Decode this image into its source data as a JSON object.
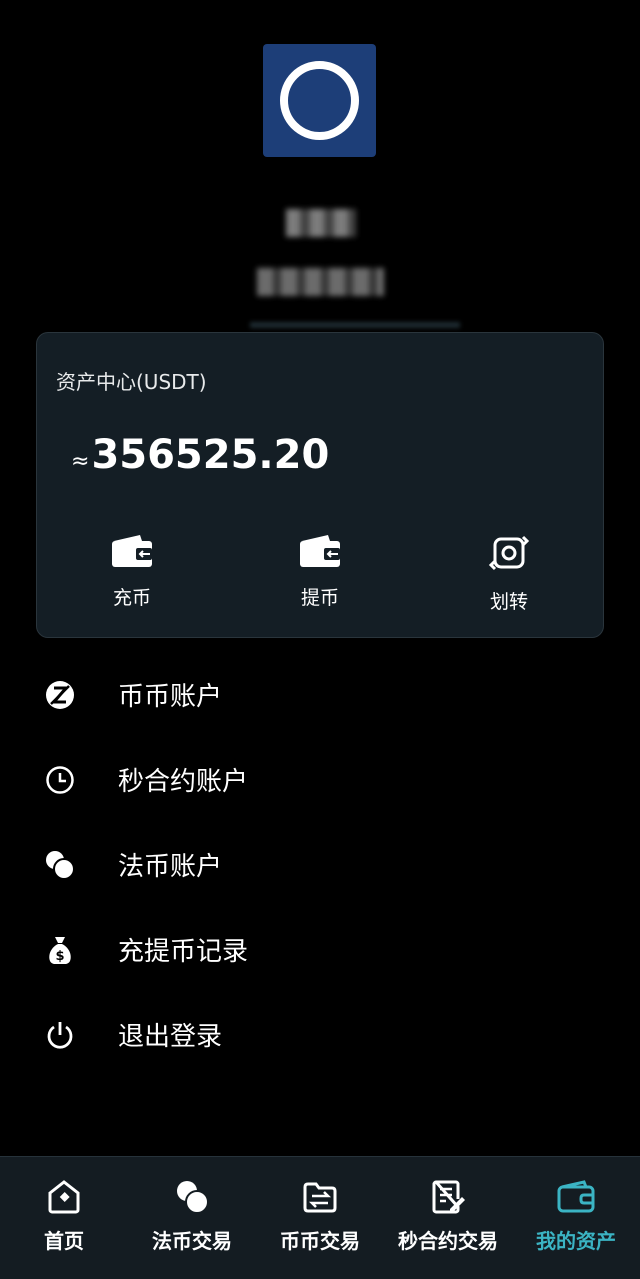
{
  "card": {
    "title": "资产中心(USDT)",
    "approx": "≈",
    "balance": "356525.20",
    "actions": [
      {
        "label": "充币",
        "icon": "wallet-deposit-icon"
      },
      {
        "label": "提币",
        "icon": "wallet-withdraw-icon"
      },
      {
        "label": "划转",
        "icon": "transfer-icon"
      }
    ]
  },
  "menu": {
    "items": [
      {
        "label": "币币账户",
        "icon": "coin-account-icon"
      },
      {
        "label": "秒合约账户",
        "icon": "clock-icon"
      },
      {
        "label": "法币账户",
        "icon": "fiat-circles-icon"
      },
      {
        "label": "充提币记录",
        "icon": "money-bag-icon"
      },
      {
        "label": "退出登录",
        "icon": "power-icon"
      }
    ]
  },
  "nav": {
    "items": [
      {
        "label": "首页",
        "icon": "home-icon"
      },
      {
        "label": "法币交易",
        "icon": "fiat-trade-icon"
      },
      {
        "label": "币币交易",
        "icon": "folder-exchange-icon"
      },
      {
        "label": "秒合约交易",
        "icon": "contract-icon"
      },
      {
        "label": "我的资产",
        "icon": "wallet-icon"
      }
    ],
    "active_color": "#3bb4c4"
  },
  "colors": {
    "background": "#000000",
    "card": "#141e25",
    "logo": "#1d3e78"
  }
}
